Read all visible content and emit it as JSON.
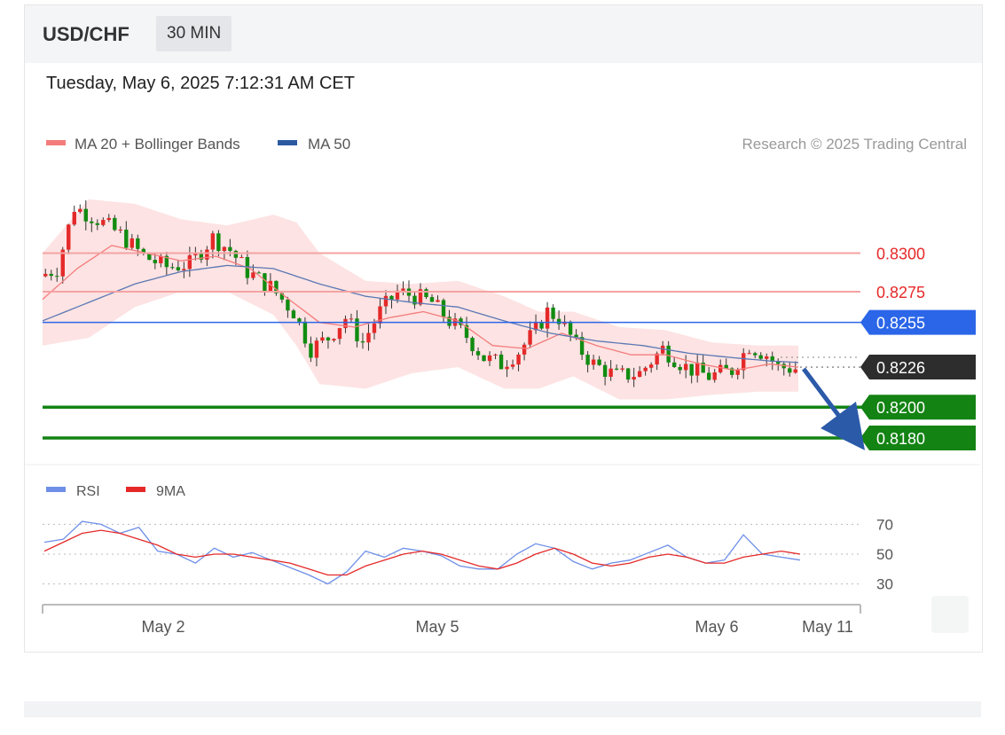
{
  "header": {
    "symbol": "USD/CHF",
    "timeframe": "30 MIN",
    "timestamp": "Tuesday, May 6, 2025 7:12:31 AM CET"
  },
  "legend": {
    "items": [
      {
        "label": "MA 20 + Bollinger Bands",
        "color": "#f47c7c"
      },
      {
        "label": "MA 50",
        "color": "#2c5aa0"
      }
    ],
    "credit": "Research © 2025 Trading Central"
  },
  "rsi_legend": {
    "items": [
      {
        "label": "RSI",
        "color": "#6e8fe8"
      },
      {
        "label": "9MA",
        "color": "#e52929"
      }
    ]
  },
  "colors": {
    "resistance": "#f5a3a3",
    "resistance_text": "#e52929",
    "pivot": "#2b66e8",
    "current": "#2d2d2d",
    "support": "#138313",
    "band_fill": "#fde3e3",
    "up_candle": "#e52929",
    "down_candle": "#118c11",
    "arrow": "#2b5aa8"
  },
  "chart_data": [
    {
      "type": "candlestick",
      "title": "USD/CHF 30 MIN",
      "x_tick_labels": [
        "May 2",
        "May 5",
        "May 6",
        "May 11"
      ],
      "ylim": [
        0.8165,
        0.8355
      ],
      "levels": [
        {
          "value": 0.83,
          "label": "0.8300",
          "kind": "resistance"
        },
        {
          "value": 0.8275,
          "label": "0.8275",
          "kind": "resistance"
        },
        {
          "value": 0.8255,
          "label": "0.8255",
          "kind": "pivot"
        },
        {
          "value": 0.8226,
          "label": "0.8226",
          "kind": "current"
        },
        {
          "value": 0.82,
          "label": "0.8200",
          "kind": "support"
        },
        {
          "value": 0.818,
          "label": "0.8180",
          "kind": "support"
        }
      ],
      "forecast_arrow": {
        "from": 0.8226,
        "to": 0.818,
        "direction": "down"
      },
      "close_path": [
        [
          0,
          0.8285
        ],
        [
          3,
          0.829
        ],
        [
          6,
          0.833
        ],
        [
          10,
          0.8322
        ],
        [
          14,
          0.8312
        ],
        [
          18,
          0.8298
        ],
        [
          22,
          0.8291
        ],
        [
          26,
          0.8293
        ],
        [
          30,
          0.831
        ],
        [
          33,
          0.8302
        ],
        [
          36,
          0.8288
        ],
        [
          40,
          0.8278
        ],
        [
          44,
          0.8262
        ],
        [
          47,
          0.8238
        ],
        [
          50,
          0.8245
        ],
        [
          53,
          0.8258
        ],
        [
          56,
          0.8242
        ],
        [
          59,
          0.8262
        ],
        [
          62,
          0.8275
        ],
        [
          65,
          0.8272
        ],
        [
          68,
          0.8268
        ],
        [
          71,
          0.8256
        ],
        [
          74,
          0.8246
        ],
        [
          77,
          0.8232
        ],
        [
          80,
          0.8228
        ],
        [
          83,
          0.8236
        ],
        [
          86,
          0.825
        ],
        [
          88,
          0.8262
        ],
        [
          90,
          0.8258
        ],
        [
          93,
          0.824
        ],
        [
          96,
          0.8228
        ],
        [
          100,
          0.822
        ],
        [
          104,
          0.8222
        ],
        [
          108,
          0.8238
        ],
        [
          112,
          0.8226
        ],
        [
          116,
          0.822
        ],
        [
          120,
          0.8224
        ],
        [
          123,
          0.824
        ],
        [
          126,
          0.8234
        ],
        [
          128,
          0.8226
        ],
        [
          131,
          0.8225
        ]
      ],
      "ma20_path": [
        [
          0,
          0.827
        ],
        [
          6,
          0.829
        ],
        [
          12,
          0.8305
        ],
        [
          18,
          0.83
        ],
        [
          24,
          0.8295
        ],
        [
          30,
          0.8298
        ],
        [
          36,
          0.829
        ],
        [
          42,
          0.8272
        ],
        [
          48,
          0.8255
        ],
        [
          54,
          0.8252
        ],
        [
          60,
          0.8258
        ],
        [
          66,
          0.8262
        ],
        [
          72,
          0.8256
        ],
        [
          78,
          0.824
        ],
        [
          84,
          0.8238
        ],
        [
          90,
          0.8248
        ],
        [
          96,
          0.824
        ],
        [
          102,
          0.8234
        ],
        [
          108,
          0.8234
        ],
        [
          114,
          0.8228
        ],
        [
          120,
          0.8224
        ],
        [
          126,
          0.8228
        ],
        [
          131,
          0.8226
        ]
      ],
      "ma50_path": [
        [
          0,
          0.8256
        ],
        [
          8,
          0.8268
        ],
        [
          16,
          0.828
        ],
        [
          24,
          0.8288
        ],
        [
          32,
          0.8292
        ],
        [
          40,
          0.829
        ],
        [
          48,
          0.828
        ],
        [
          56,
          0.8272
        ],
        [
          64,
          0.8268
        ],
        [
          72,
          0.8265
        ],
        [
          80,
          0.8256
        ],
        [
          88,
          0.8248
        ],
        [
          96,
          0.8243
        ],
        [
          104,
          0.824
        ],
        [
          112,
          0.8235
        ],
        [
          120,
          0.8232
        ],
        [
          126,
          0.823
        ],
        [
          131,
          0.8229
        ]
      ],
      "bollinger_upper": [
        [
          0,
          0.83
        ],
        [
          8,
          0.8335
        ],
        [
          16,
          0.8332
        ],
        [
          24,
          0.8322
        ],
        [
          32,
          0.8318
        ],
        [
          40,
          0.8325
        ],
        [
          44,
          0.832
        ],
        [
          48,
          0.83
        ],
        [
          56,
          0.8282
        ],
        [
          64,
          0.828
        ],
        [
          72,
          0.8282
        ],
        [
          80,
          0.8272
        ],
        [
          86,
          0.8262
        ],
        [
          92,
          0.8262
        ],
        [
          100,
          0.8252
        ],
        [
          108,
          0.825
        ],
        [
          116,
          0.8242
        ],
        [
          124,
          0.824
        ],
        [
          131,
          0.824
        ]
      ],
      "bollinger_lower": [
        [
          0,
          0.824
        ],
        [
          8,
          0.8245
        ],
        [
          16,
          0.8265
        ],
        [
          24,
          0.8275
        ],
        [
          32,
          0.8275
        ],
        [
          40,
          0.826
        ],
        [
          44,
          0.824
        ],
        [
          48,
          0.8215
        ],
        [
          56,
          0.8212
        ],
        [
          64,
          0.8222
        ],
        [
          72,
          0.8226
        ],
        [
          80,
          0.8212
        ],
        [
          86,
          0.8212
        ],
        [
          92,
          0.822
        ],
        [
          100,
          0.8205
        ],
        [
          108,
          0.8205
        ],
        [
          116,
          0.8208
        ],
        [
          124,
          0.821
        ],
        [
          131,
          0.821
        ]
      ]
    },
    {
      "type": "line",
      "title": "",
      "series": [
        {
          "name": "RSI",
          "values": [
            58,
            60,
            72,
            70,
            64,
            68,
            52,
            50,
            44,
            54,
            48,
            51,
            46,
            41,
            36,
            30,
            38,
            52,
            48,
            54,
            52,
            49,
            42,
            40,
            40,
            50,
            57,
            54,
            45,
            40,
            44,
            46,
            51,
            56,
            48,
            44,
            46,
            63,
            50,
            48,
            46
          ]
        },
        {
          "name": "9MA",
          "values": [
            52,
            58,
            64,
            66,
            64,
            60,
            56,
            50,
            48,
            50,
            50,
            48,
            46,
            44,
            40,
            36,
            36,
            42,
            46,
            50,
            52,
            50,
            46,
            42,
            40,
            44,
            50,
            54,
            50,
            44,
            42,
            44,
            48,
            50,
            48,
            44,
            44,
            48,
            50,
            52,
            50
          ]
        }
      ],
      "yticks": [
        30,
        50,
        70
      ],
      "ylim": [
        22,
        78
      ]
    }
  ]
}
